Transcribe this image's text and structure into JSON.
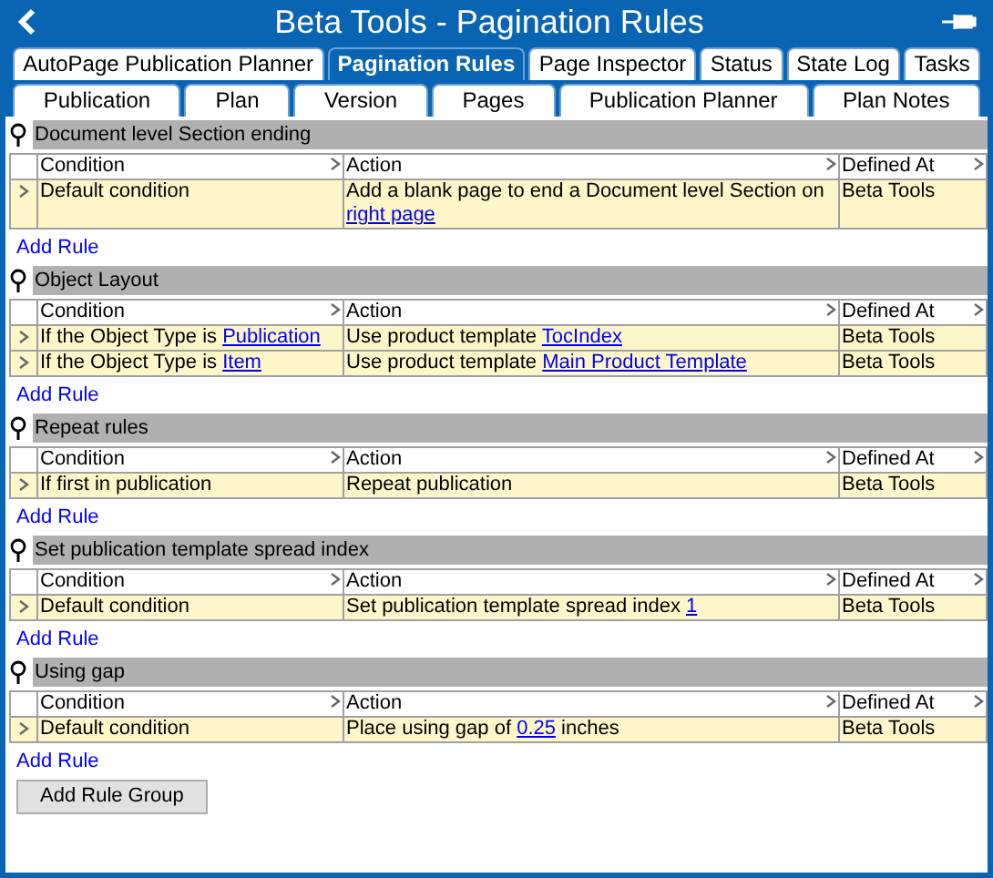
{
  "window": {
    "title": "Beta Tools - Pagination Rules"
  },
  "tab_rows": [
    [
      {
        "label": "AutoPage Publication Planner",
        "selected": false
      },
      {
        "label": "Pagination Rules",
        "selected": true
      },
      {
        "label": "Page Inspector",
        "selected": false
      },
      {
        "label": "Status",
        "selected": false
      },
      {
        "label": "State Log",
        "selected": false
      },
      {
        "label": "Tasks",
        "selected": false
      }
    ],
    [
      {
        "label": "Publication",
        "selected": false
      },
      {
        "label": "Plan",
        "selected": false
      },
      {
        "label": "Version",
        "selected": false
      },
      {
        "label": "Pages",
        "selected": false
      },
      {
        "label": "Publication Planner",
        "selected": false
      },
      {
        "label": "Plan Notes",
        "selected": false
      }
    ]
  ],
  "rule_groups": [
    {
      "title": "Document level Section ending",
      "columns": [
        "Condition",
        "Action",
        "Defined At"
      ],
      "rows": [
        {
          "condition": [
            {
              "kind": "text",
              "text": "Default condition"
            }
          ],
          "action": [
            {
              "kind": "text",
              "text": "Add a blank page to end a Document level Section on "
            },
            {
              "kind": "link",
              "text": "right page"
            }
          ],
          "defined_at": "Beta Tools"
        }
      ],
      "add_rule": "Add Rule"
    },
    {
      "title": "Object Layout",
      "columns": [
        "Condition",
        "Action",
        "Defined At"
      ],
      "rows": [
        {
          "condition": [
            {
              "kind": "text",
              "text": "If the Object Type is "
            },
            {
              "kind": "link",
              "text": "Publication"
            }
          ],
          "action": [
            {
              "kind": "text",
              "text": "Use product template "
            },
            {
              "kind": "link",
              "text": "TocIndex"
            }
          ],
          "defined_at": "Beta Tools"
        },
        {
          "condition": [
            {
              "kind": "text",
              "text": "If the Object Type is "
            },
            {
              "kind": "link",
              "text": "Item"
            }
          ],
          "action": [
            {
              "kind": "text",
              "text": "Use product template "
            },
            {
              "kind": "link",
              "text": "Main Product Template"
            }
          ],
          "defined_at": "Beta Tools"
        }
      ],
      "add_rule": "Add Rule"
    },
    {
      "title": "Repeat rules",
      "columns": [
        "Condition",
        "Action",
        "Defined At"
      ],
      "rows": [
        {
          "condition": [
            {
              "kind": "text",
              "text": "If first in publication"
            }
          ],
          "action": [
            {
              "kind": "text",
              "text": "Repeat publication"
            }
          ],
          "defined_at": "Beta Tools"
        }
      ],
      "add_rule": "Add Rule"
    },
    {
      "title": "Set publication template spread index",
      "columns": [
        "Condition",
        "Action",
        "Defined At"
      ],
      "rows": [
        {
          "condition": [
            {
              "kind": "text",
              "text": "Default condition"
            }
          ],
          "action": [
            {
              "kind": "text",
              "text": "Set publication template spread index "
            },
            {
              "kind": "link",
              "text": "1"
            }
          ],
          "defined_at": "Beta Tools"
        }
      ],
      "add_rule": "Add Rule"
    },
    {
      "title": "Using gap",
      "columns": [
        "Condition",
        "Action",
        "Defined At"
      ],
      "rows": [
        {
          "condition": [
            {
              "kind": "text",
              "text": "Default condition"
            }
          ],
          "action": [
            {
              "kind": "text",
              "text": "Place using gap of "
            },
            {
              "kind": "link",
              "text": "0.25"
            },
            {
              "kind": "text",
              "text": " inches"
            }
          ],
          "defined_at": "Beta Tools"
        }
      ],
      "add_rule": "Add Rule"
    }
  ],
  "add_rule_group_button": "Add Rule Group"
}
